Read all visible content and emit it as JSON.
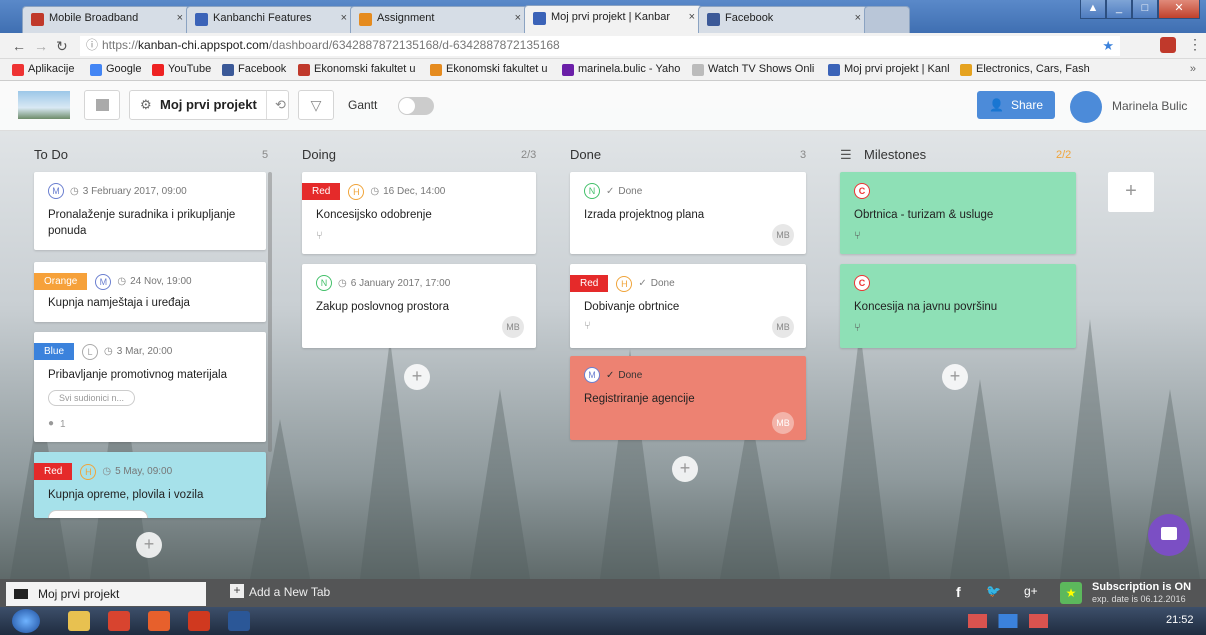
{
  "browser": {
    "tabs": [
      {
        "label": "Mobile Broadband",
        "color": "#c0392b"
      },
      {
        "label": "Kanbanchi Features",
        "color": "#3b63b8"
      },
      {
        "label": "Assignment",
        "color": "#e58b1f"
      },
      {
        "label": "Moj prvi projekt | Kanbar",
        "color": "#3b63b8"
      },
      {
        "label": "Facebook",
        "color": "#3b5998"
      }
    ],
    "close_glyph": "×",
    "win_controls": [
      "▲",
      "_",
      "□",
      "✕"
    ],
    "url_scheme": "https://",
    "url_host": "kanban-chi.appspot.com",
    "url_path": "/dashboard/6342887872135168/d-6342887872135168",
    "bookmarks": [
      {
        "label": "Aplikacije",
        "color": "#e33"
      },
      {
        "label": "Google",
        "color": "#4285f4"
      },
      {
        "label": "YouTube",
        "color": "#e22"
      },
      {
        "label": "Facebook",
        "color": "#3b5998"
      },
      {
        "label": "Ekonomski fakultet u",
        "color": "#c0392b"
      },
      {
        "label": "Ekonomski fakultet u",
        "color": "#e58b1f"
      },
      {
        "label": "marinela.bulic - Yaho",
        "color": "#6b1fa8"
      },
      {
        "label": "Watch TV Shows Onli",
        "color": "#999"
      },
      {
        "label": "Moj prvi projekt | Kanl",
        "color": "#3b63b8"
      },
      {
        "label": "Electronics, Cars, Fash",
        "color": "#e5a21f"
      }
    ],
    "bookmarks_more": "»"
  },
  "header": {
    "project_name": "Moj prvi projekt",
    "gantt_label": "Gantt",
    "share_label": "Share",
    "user_name": "Marinela Bulic"
  },
  "columns": [
    {
      "title": "To Do",
      "count": "5"
    },
    {
      "title": "Doing",
      "count": "2/3"
    },
    {
      "title": "Done",
      "count": "3"
    },
    {
      "title": "Milestones",
      "count": "2/2"
    }
  ],
  "cards": {
    "todo": [
      {
        "avatar": "M",
        "date": "3 February 2017, 09:00",
        "title": "Pronalaženje suradnika i prikupljanje ponuda"
      },
      {
        "tag": "Orange",
        "avatar": "M",
        "date": "24 Nov, 19:00",
        "title": "Kupnja namještaja i uređaja"
      },
      {
        "tag": "Blue",
        "avatar": "L",
        "date": "3 Mar, 20:00",
        "title": "Pribavljanje promotivnog materijala",
        "chip": "Svi sudionici n...",
        "comments": "1"
      },
      {
        "tag": "Red",
        "avatar": "H",
        "date": "5 May, 09:00",
        "title": "Kupnja opreme, plovila i vozila"
      }
    ],
    "doing": [
      {
        "tag": "Red",
        "avatar": "H",
        "date": "16 Dec, 14:00",
        "title": "Koncesijsko odobrenje"
      },
      {
        "avatar": "N",
        "date": "6 January 2017, 17:00",
        "title": "Zakup poslovnog prostora",
        "assignee": "MB"
      }
    ],
    "done": [
      {
        "avatar": "N",
        "status": "Done",
        "title": "Izrada projektnog plana",
        "assignee": "MB"
      },
      {
        "tag": "Red",
        "avatar": "H",
        "status": "Done",
        "title": "Dobivanje obrtnice",
        "assignee": "MB"
      },
      {
        "avatar": "M",
        "status": "Done",
        "title": "Registriranje agencije",
        "assignee": "MB"
      }
    ],
    "milestones": [
      {
        "avatar": "C",
        "title": "Obrtnica - turizam & usluge"
      },
      {
        "avatar": "C",
        "title": "Koncesija na javnu površinu"
      }
    ]
  },
  "footer": {
    "tab_label": "Moj prvi projekt",
    "add_tab_label": "Add a New Tab",
    "subscription_title": "Subscription is ON",
    "subscription_sub": "exp. date is 06.12.2016",
    "social": [
      "f",
      "🐦",
      "g+"
    ]
  },
  "taskbar": {
    "time": "21:52"
  },
  "colors": {
    "accent": "#4c8bd9",
    "milestone_card": "#8ee0b6",
    "done_highlight_card": "#ed8272",
    "todo_highlight_card": "#a6e1ea",
    "tag_red": "#e52a2a",
    "tag_orange": "#f6a13a",
    "tag_blue": "#3b82dc"
  }
}
